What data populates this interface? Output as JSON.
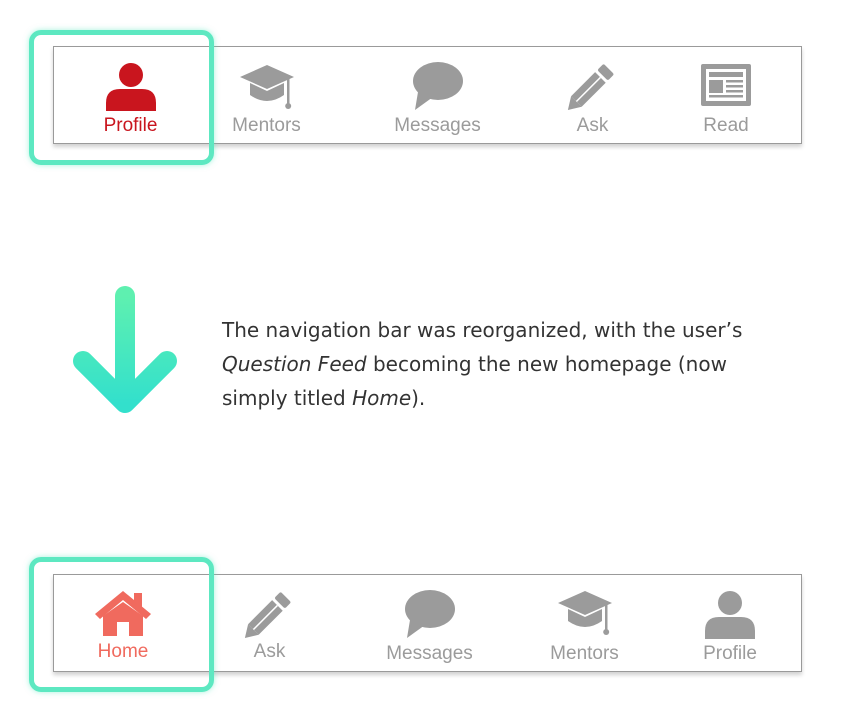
{
  "colors": {
    "active_profile": "#c9151e",
    "active_home": "#f06a5e",
    "inactive": "#9b9b9b",
    "highlight": "#5de8c1"
  },
  "top_nav": {
    "items": [
      {
        "label": "Profile",
        "icon": "user-icon",
        "active": true
      },
      {
        "label": "Mentors",
        "icon": "graduation-cap-icon",
        "active": false
      },
      {
        "label": "Messages",
        "icon": "speech-bubble-icon",
        "active": false
      },
      {
        "label": "Ask",
        "icon": "pencil-icon",
        "active": false
      },
      {
        "label": "Read",
        "icon": "newspaper-icon",
        "active": false
      }
    ]
  },
  "note": {
    "part1": "The navigation bar was reorganized, with the user’s ",
    "emph1": "Question Feed",
    "part2": " becoming the new homepage (now simply titled ",
    "emph2": "Home",
    "part3": ")."
  },
  "bottom_nav": {
    "items": [
      {
        "label": "Home",
        "icon": "home-icon",
        "active": true
      },
      {
        "label": "Ask",
        "icon": "pencil-icon",
        "active": false
      },
      {
        "label": "Messages",
        "icon": "speech-bubble-icon",
        "active": false
      },
      {
        "label": "Mentors",
        "icon": "graduation-cap-icon",
        "active": false
      },
      {
        "label": "Profile",
        "icon": "user-icon",
        "active": false
      }
    ]
  }
}
